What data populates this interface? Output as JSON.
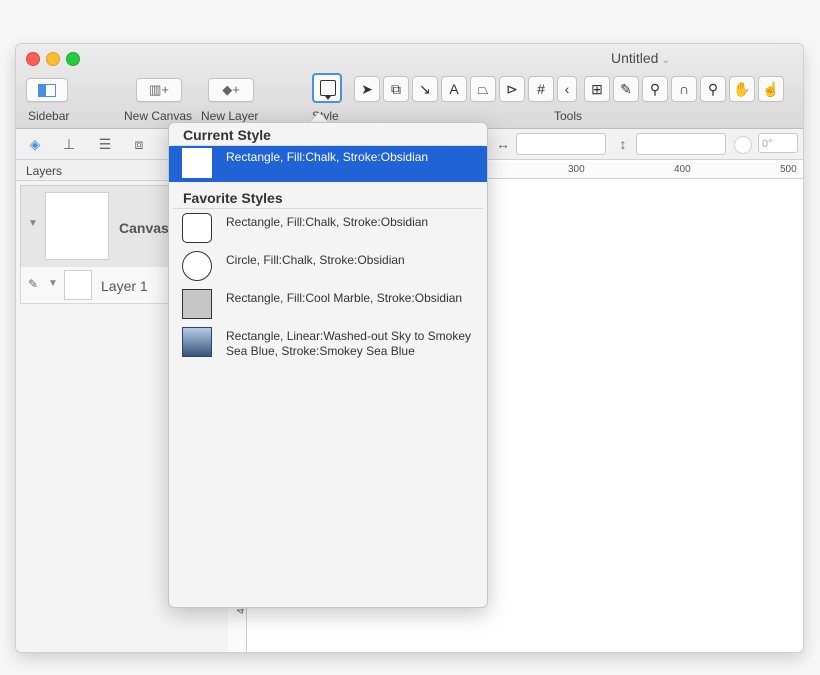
{
  "window": {
    "title": "Untitled"
  },
  "toolbar": {
    "sidebar_label": "Sidebar",
    "new_canvas_label": "New Canvas",
    "new_layer_label": "New Layer",
    "style_label": "Style",
    "tools_label": "Tools"
  },
  "inspector": {
    "rotation_value": "0°"
  },
  "layers": {
    "header": "Layers",
    "canvas_name": "Canvas",
    "layer_name": "Layer 1"
  },
  "ruler": {
    "top_ticks": [
      "300",
      "400",
      "500"
    ],
    "left_tick": "400"
  },
  "popover": {
    "current_title": "Current Style",
    "current_style": "Rectangle, Fill:Chalk, Stroke:Obsidian",
    "favorites_title": "Favorite Styles",
    "favorites": [
      "Rectangle, Fill:Chalk, Stroke:Obsidian",
      "Circle, Fill:Chalk, Stroke:Obsidian",
      "Rectangle, Fill:Cool Marble, Stroke:Obsidian",
      "Rectangle, Linear:Washed-out Sky to Smokey Sea Blue, Stroke:Smokey Sea Blue"
    ]
  },
  "colors": {
    "accent": "#1f63d6",
    "close": "#fc5f57",
    "minimize": "#fdbc2e",
    "zoom": "#28c840"
  }
}
